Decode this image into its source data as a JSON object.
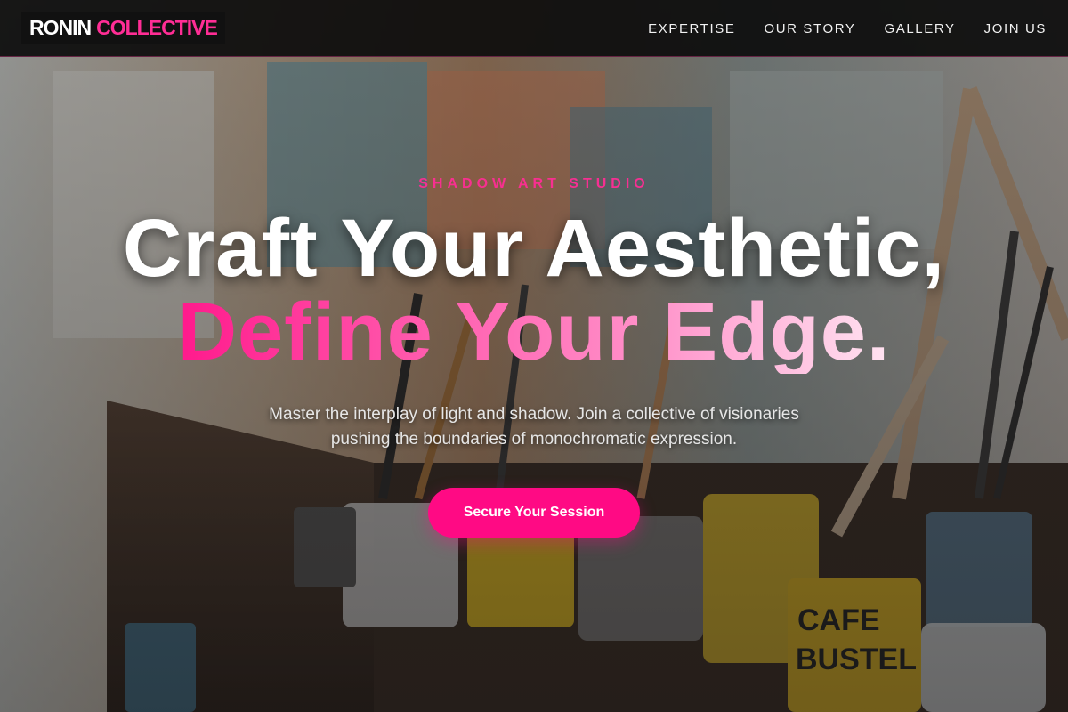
{
  "brand": {
    "name_primary": "RONIN",
    "name_accent": "COLLECTIVE",
    "accent_color": "#ff2d95"
  },
  "nav": {
    "items": [
      {
        "label": "EXPERTISE"
      },
      {
        "label": "OUR STORY"
      },
      {
        "label": "GALLERY"
      },
      {
        "label": "JOIN US"
      }
    ]
  },
  "hero": {
    "eyebrow": "SHADOW ART STUDIO",
    "headline_line1": "Craft Your Aesthetic,",
    "headline_line2": "Define Your Edge.",
    "subtext": "Master the interplay of light and shadow. Join a collective of visionaries pushing the boundaries of monochromatic expression.",
    "cta_label": "Secure Your Session",
    "cta_color": "#ff0a84",
    "background": "paint-studio-photo"
  }
}
